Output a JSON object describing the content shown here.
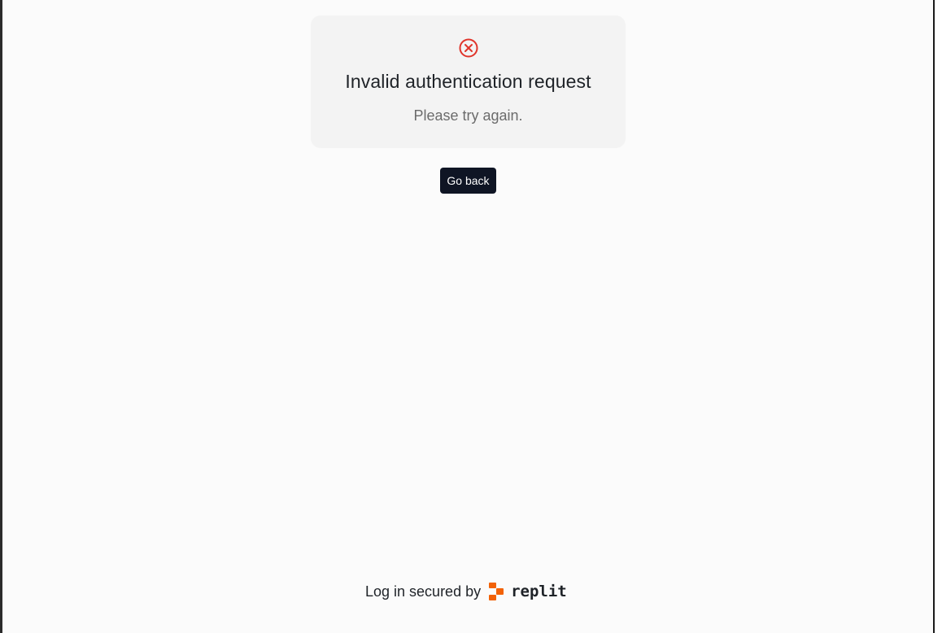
{
  "error_card": {
    "icon": "circle-x-icon",
    "icon_color": "#e0352b",
    "title": "Invalid authentication request",
    "subtitle": "Please try again."
  },
  "actions": {
    "go_back_label": "Go back"
  },
  "footer": {
    "secured_text": "Log in secured by",
    "brand_name": "replit",
    "brand_color": "#f26207"
  }
}
